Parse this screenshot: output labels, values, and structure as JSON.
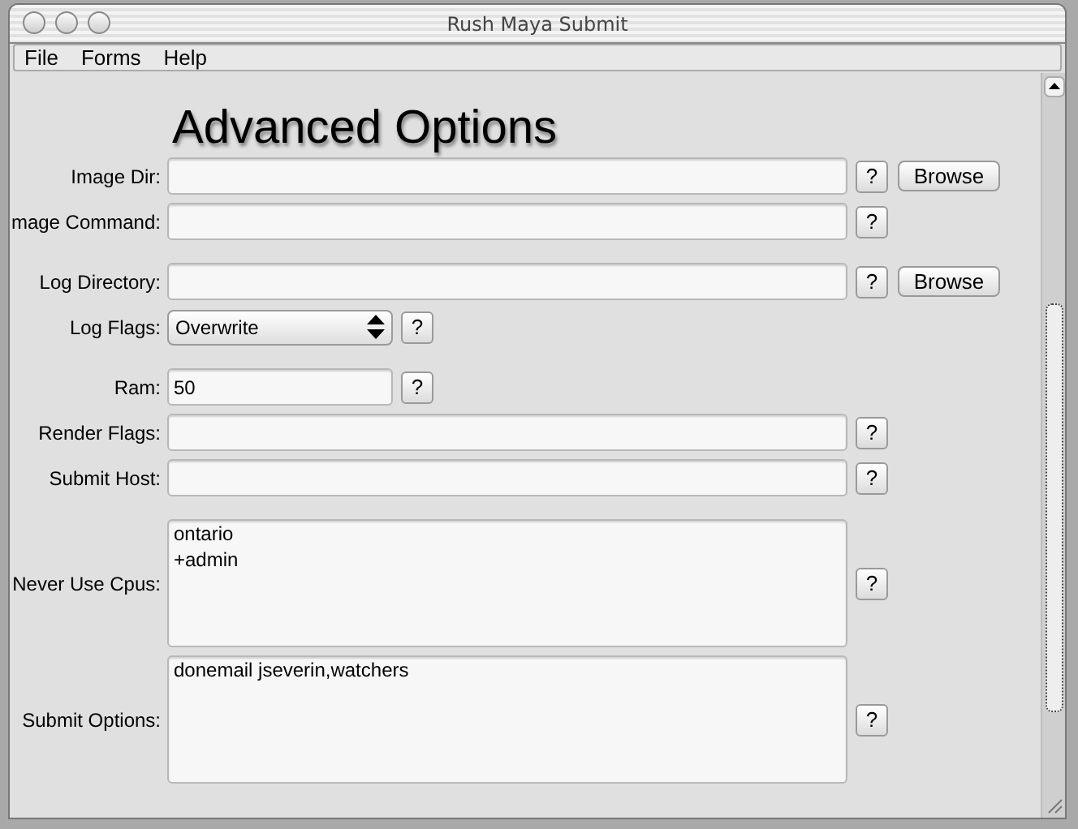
{
  "window": {
    "title": "Rush Maya Submit"
  },
  "menu": [
    "File",
    "Forms",
    "Help"
  ],
  "heading": "Advanced Options",
  "groups": [
    [
      {
        "kind": "text",
        "label": "Image Dir:",
        "help": "?",
        "browse": "Browse"
      },
      {
        "kind": "text",
        "label": "mage Command:",
        "help": "?"
      }
    ],
    [
      {
        "kind": "text",
        "label": "Log Directory:",
        "help": "?",
        "browse": "Browse"
      },
      {
        "kind": "select",
        "label": "Log Flags:",
        "value": "Overwrite",
        "help": "?"
      }
    ],
    [
      {
        "kind": "short",
        "label": "Ram:",
        "value": "50",
        "help": "?"
      },
      {
        "kind": "text",
        "label": "Render Flags:",
        "help": "?"
      },
      {
        "kind": "text",
        "label": "Submit Host:",
        "help": "?"
      }
    ],
    [
      {
        "kind": "area",
        "label": "Never Use Cpus:",
        "value": "ontario\n+admin",
        "help": "?"
      },
      {
        "kind": "area",
        "label": "Submit Options:",
        "value": "donemail jseverin,watchers",
        "help": "?"
      }
    ]
  ]
}
